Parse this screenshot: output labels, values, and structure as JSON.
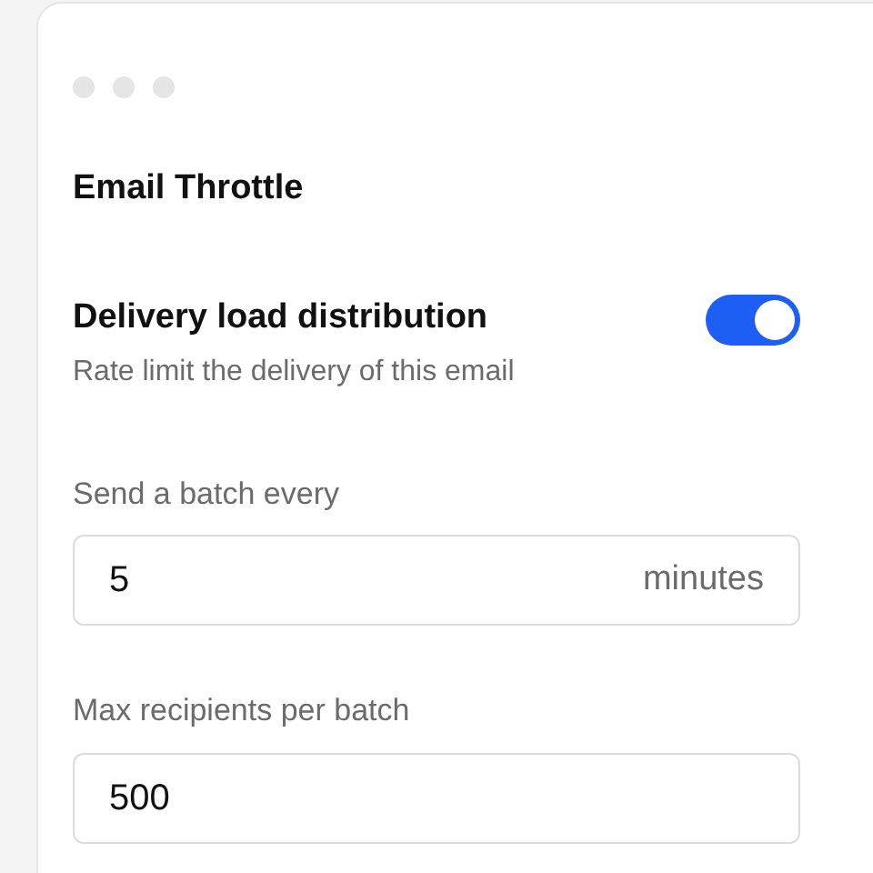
{
  "window": {
    "title": "Email Throttle"
  },
  "setting": {
    "label": "Delivery load distribution",
    "description": "Rate limit the delivery of this email",
    "on": true
  },
  "fields": [
    {
      "label": "Send a batch every",
      "value": "5",
      "suffix": "minutes"
    },
    {
      "label": "Max recipients per batch",
      "value": "500"
    }
  ]
}
